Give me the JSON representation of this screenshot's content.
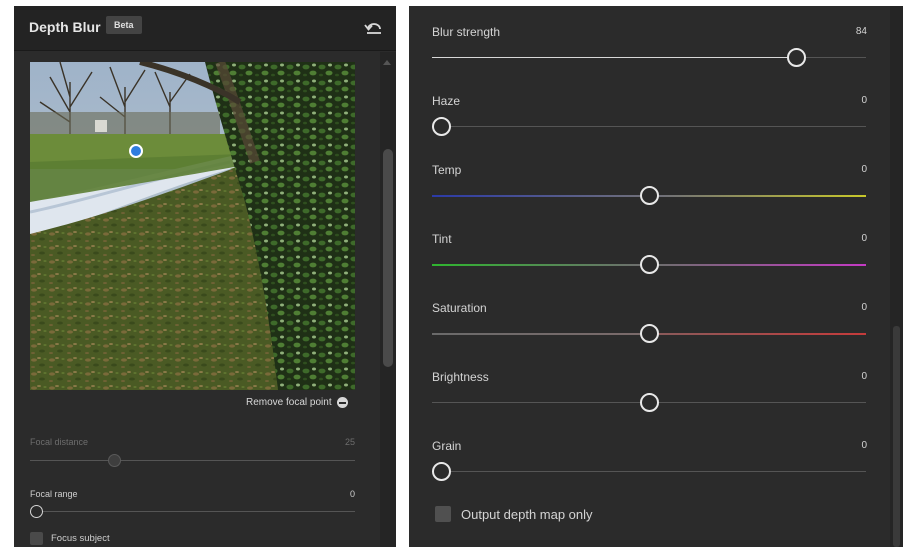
{
  "header": {
    "title": "Depth Blur",
    "badge": "Beta"
  },
  "image_panel": {
    "remove_focal_label": "Remove focal point"
  },
  "left_sliders": {
    "focal_distance": {
      "label": "Focal distance",
      "value": "25",
      "position": 0.26,
      "enabled": false
    },
    "focal_range": {
      "label": "Focal range",
      "value": "0",
      "position": 0.0,
      "enabled": true
    }
  },
  "focus_subject": {
    "label": "Focus subject",
    "checked": false
  },
  "right_sliders": [
    {
      "key": "blur_strength",
      "label": "Blur strength",
      "value": "84",
      "position": 0.84,
      "style": "blur"
    },
    {
      "key": "haze",
      "label": "Haze",
      "value": "0",
      "position": 0.0,
      "style": "plain"
    },
    {
      "key": "temp",
      "label": "Temp",
      "value": "0",
      "position": 0.5,
      "style": "temp"
    },
    {
      "key": "tint",
      "label": "Tint",
      "value": "0",
      "position": 0.5,
      "style": "tint"
    },
    {
      "key": "saturation",
      "label": "Saturation",
      "value": "0",
      "position": 0.5,
      "style": "saturation"
    },
    {
      "key": "brightness",
      "label": "Brightness",
      "value": "0",
      "position": 0.5,
      "style": "plain"
    },
    {
      "key": "grain",
      "label": "Grain",
      "value": "0",
      "position": 0.0,
      "style": "plain"
    }
  ],
  "output_depth_map": {
    "label": "Output depth map only",
    "checked": false
  },
  "colors": {
    "panel_bg": "#2b2b2b",
    "header_bg": "#232323",
    "focal_point": "#2f7de0"
  },
  "icons": {
    "reset": "reset-arrow-icon",
    "remove": "minus-circle-icon"
  }
}
